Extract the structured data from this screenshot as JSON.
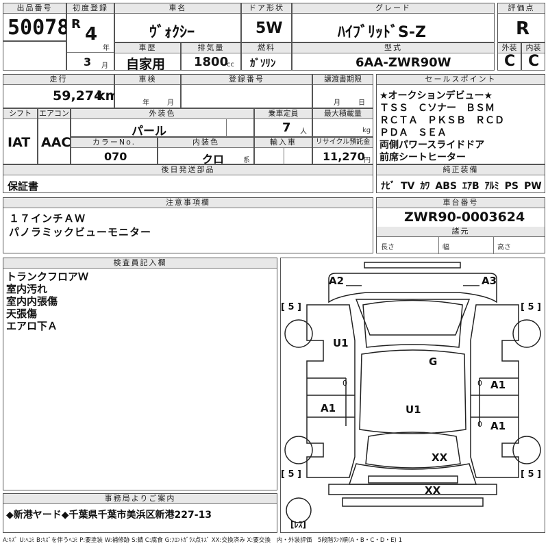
{
  "headers": {
    "lot_no": "出品番号",
    "first_reg": "初度登録",
    "car_name": "車名",
    "door_type": "ドア形状",
    "grade": "グレード",
    "score": "評価点",
    "history": "車歴",
    "displacement": "排気量",
    "fuel": "燃料",
    "model": "型式",
    "exterior": "外装",
    "interior": "内装",
    "mileage": "走行",
    "inspection": "車検",
    "reg_no": "登録番号",
    "transfer_deadline": "譲渡書期限",
    "sales_points": "セールスポイント",
    "shift": "シフト",
    "aircon": "エアコン",
    "ext_color": "外装色",
    "capacity": "乗車定員",
    "max_load": "最大積載量",
    "color_no": "カラーNo.",
    "int_color": "内装色",
    "import": "輸入車",
    "recycle": "リサイクル預託金",
    "later_parts": "後日発送部品",
    "genuine_equipment": "純正装備",
    "notes": "注意事項欄",
    "chassis_no": "車台番号",
    "dimensions": "諸元",
    "inspector_notes": "検査員記入欄",
    "office_info": "事務局よりご案内"
  },
  "vehicle": {
    "lot_no": "50078",
    "era": "R",
    "year": "4",
    "year_unit": "年",
    "month": "3",
    "month_unit": "月",
    "car_name": "ｳﾞｫｸｼｰ",
    "door": "5W",
    "grade": "ﾊｲﾌﾞﾘｯﾄﾞS-Z",
    "score": "R",
    "history": "自家用",
    "displacement": "1800",
    "displacement_unit": "cc",
    "fuel": "ｶﾞｿﾘﾝ",
    "model": "6AA-ZWR90W",
    "exterior_grade": "C",
    "interior_grade": "C",
    "mileage": "59,274",
    "mileage_unit": "km",
    "inspection_year_unit": "年",
    "inspection_month_unit": "月",
    "transfer_month_unit": "月",
    "transfer_day_unit": "日",
    "shift": "IAT",
    "aircon": "AAC",
    "ext_color": "パール",
    "capacity": "7",
    "capacity_unit": "人",
    "max_load_unit": "kg",
    "color_no": "070",
    "int_color": "クロ",
    "int_color_unit": "系",
    "recycle": "11,270",
    "recycle_unit": "円",
    "later_parts": "保証書",
    "chassis_no": "ZWR90-0003624",
    "length_label": "長さ",
    "width_label": "幅",
    "height_label": "高さ"
  },
  "sales_points": [
    "★オークションデビュー★",
    "ＴＳＳ　Ｃソナー　ＢＳＭ",
    "ＲＣＴＡ　ＰＫＳＢ　ＲＣＤ",
    "ＰＤＡ　ＳＥＡ",
    "両側パワースライドドア",
    "前席シートヒーター"
  ],
  "equipment": [
    "ﾅﾋﾞ",
    "TV",
    "ｶﾜ",
    "ABS",
    "ｴｱB",
    "ｱﾙﾐ",
    "PS",
    "PW"
  ],
  "notes": [
    "１７インチＡＷ",
    "パノラミックビューモニター"
  ],
  "inspector_notes": [
    "トランクフロアＷ",
    "室内汚れ",
    "室内内張傷",
    "天張傷",
    "エアロ下Ａ"
  ],
  "office_info": "◆新港ヤード◆千葉県千葉市美浜区新港227-13",
  "legend": "A:ｷｽﾞ U:ﾍｺﾐ B:ｷｽﾞを伴うﾍｺﾐ P:要塗装 W:補修跡 S:錆 C:腐食 G:ﾌﾛﾝﾄｶﾞﾗｽ点ｷｽﾞ XX:交換済み X:要交換　内・外装評価　5段階ﾗﾝｸ順(A・B・C・D・E) 1",
  "diagram": {
    "labels": {
      "a2": "A2",
      "a3": "A3",
      "u1_left": "U1",
      "g": "G",
      "a1_right_top": "A1",
      "a1_left": "A1",
      "u1_center": "U1",
      "a1_right_bottom": "A1",
      "xx_rear": "XX",
      "xx_bottom": "XX"
    },
    "tire_marks": {
      "fl": "[ 5 ]",
      "fr": "[ 5 ]",
      "rl": "[ 5 ]",
      "rr": "[ 5 ]"
    },
    "zero_left": "0",
    "zero_right": "0",
    "zero_right2": "0",
    "spare_label": "[ﾚｽ]"
  }
}
